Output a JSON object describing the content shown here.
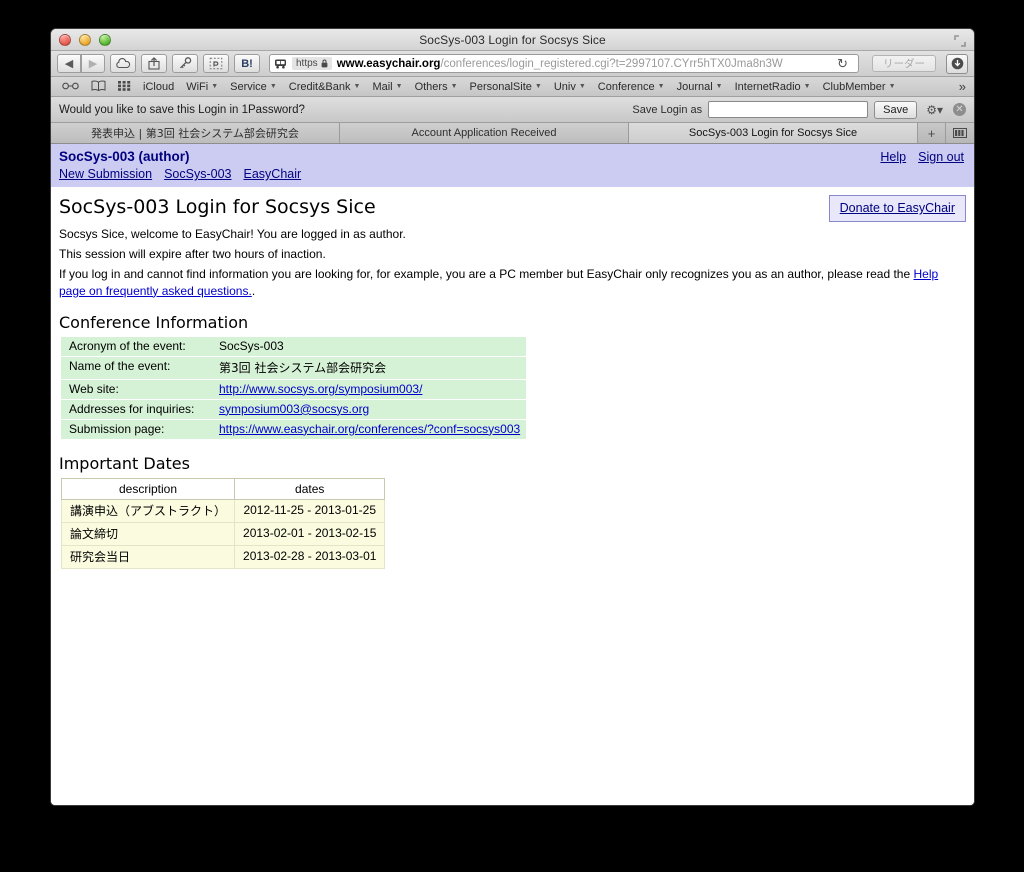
{
  "window": {
    "title": "SocSys-003 Login for Socsys Sice",
    "traffic_lights": [
      "close-red",
      "minimize-yellow",
      "zoom-green"
    ],
    "fullscreen_icon": "fullscreen-icon"
  },
  "toolbar": {
    "back_icon": "◀",
    "forward_icon": "▶",
    "icloud_icon": "cloud-icon",
    "share_icon": "share-icon",
    "onepassword_icon": "key-icon",
    "clip_icon": "clip-icon",
    "hatena_label": "B!",
    "url": {
      "scheme_label": "https",
      "lock_icon": "🔒",
      "host": "www.easychair.org",
      "path": "/conferences/login_registered.cgi?t=2997107.CYrr5hTX0Jma8n3W"
    },
    "reload_icon": "↻",
    "reader_label": "リーダー",
    "download_icon": "download-icon"
  },
  "bookmarks": {
    "items": [
      {
        "label": "",
        "icon": "reading-glasses-icon",
        "caret": false
      },
      {
        "label": "",
        "icon": "book-icon",
        "caret": false
      },
      {
        "label": "",
        "icon": "top-sites-icon",
        "caret": false
      },
      {
        "label": "iCloud",
        "icon": "",
        "caret": false
      },
      {
        "label": "WiFi",
        "icon": "",
        "caret": true
      },
      {
        "label": "Service",
        "icon": "",
        "caret": true
      },
      {
        "label": "Credit&Bank",
        "icon": "",
        "caret": true
      },
      {
        "label": "Mail",
        "icon": "",
        "caret": true
      },
      {
        "label": "Others",
        "icon": "",
        "caret": true
      },
      {
        "label": "PersonalSite",
        "icon": "",
        "caret": true
      },
      {
        "label": "Univ",
        "icon": "",
        "caret": true
      },
      {
        "label": "Conference",
        "icon": "",
        "caret": true
      },
      {
        "label": "Journal",
        "icon": "",
        "caret": true
      },
      {
        "label": "InternetRadio",
        "icon": "",
        "caret": true
      },
      {
        "label": "ClubMember",
        "icon": "",
        "caret": true
      }
    ],
    "overflow_icon": "»"
  },
  "onepassword_bar": {
    "prompt": "Would you like to save this Login in 1Password?",
    "save_login_as_label": "Save Login as",
    "input_value": "",
    "input_placeholder": "",
    "save_button": "Save",
    "gear_icon": "gear-icon",
    "close_icon": "✕"
  },
  "tabs": {
    "items": [
      {
        "label": "発表申込 | 第3回 社会システム部会研究会",
        "active": false
      },
      {
        "label": "Account Application Received",
        "active": false
      },
      {
        "label": "SocSys-003 Login for Socsys Sice",
        "active": true
      }
    ],
    "new_tab_icon": "+",
    "show_all_tabs_icon": "show-all-tabs-icon"
  },
  "ec_nav": {
    "title": "SocSys-003 (author)",
    "links": [
      "New Submission",
      "SocSys-003",
      "EasyChair"
    ],
    "right_links": [
      "Help",
      "Sign out"
    ]
  },
  "main": {
    "page_title": "SocSys-003 Login for Socsys Sice",
    "donate_label": "Donate to EasyChair",
    "paragraph1": "Socsys Sice, welcome to EasyChair! You are logged in as author.",
    "paragraph2": "This session will expire after two hours of inaction.",
    "paragraph3_pre": "If you log in and cannot find information you are looking for, for example, you are a PC member but EasyChair only recognizes you as an author, please read the ",
    "paragraph3_link": "Help page on frequently asked questions.",
    "paragraph3_post": ".",
    "conference_section_title": "Conference Information",
    "conference_info": [
      {
        "key": "Acronym of the event:",
        "value": "SocSys-003",
        "link": false
      },
      {
        "key": "Name of the event:",
        "value": "第3回 社会システム部会研究会",
        "link": false
      },
      {
        "key": "Web site:",
        "value": "http://www.socsys.org/symposium003/",
        "link": true
      },
      {
        "key": "Addresses for inquiries:",
        "value": "symposium003@socsys.org",
        "link": true
      },
      {
        "key": "Submission page:",
        "value": "https://www.easychair.org/conferences/?conf=socsys003",
        "link": true
      }
    ],
    "dates_section_title": "Important Dates",
    "dates_headers": [
      "description",
      "dates"
    ],
    "dates_rows": [
      {
        "description": "講演申込（アブストラクト）",
        "dates": "2012-11-25 - 2013-01-25"
      },
      {
        "description": "論文締切",
        "dates": "2013-02-01 - 2013-02-15"
      },
      {
        "description": "研究会当日",
        "dates": "2013-02-28 - 2013-03-01"
      }
    ]
  },
  "colors": {
    "nav_background": "#ccccf2",
    "nav_text": "#000080",
    "link": "#0000cc",
    "conference_table": "#d6f2d6",
    "dates_table": "#fbfbe0",
    "donate_border": "#8888cc"
  }
}
